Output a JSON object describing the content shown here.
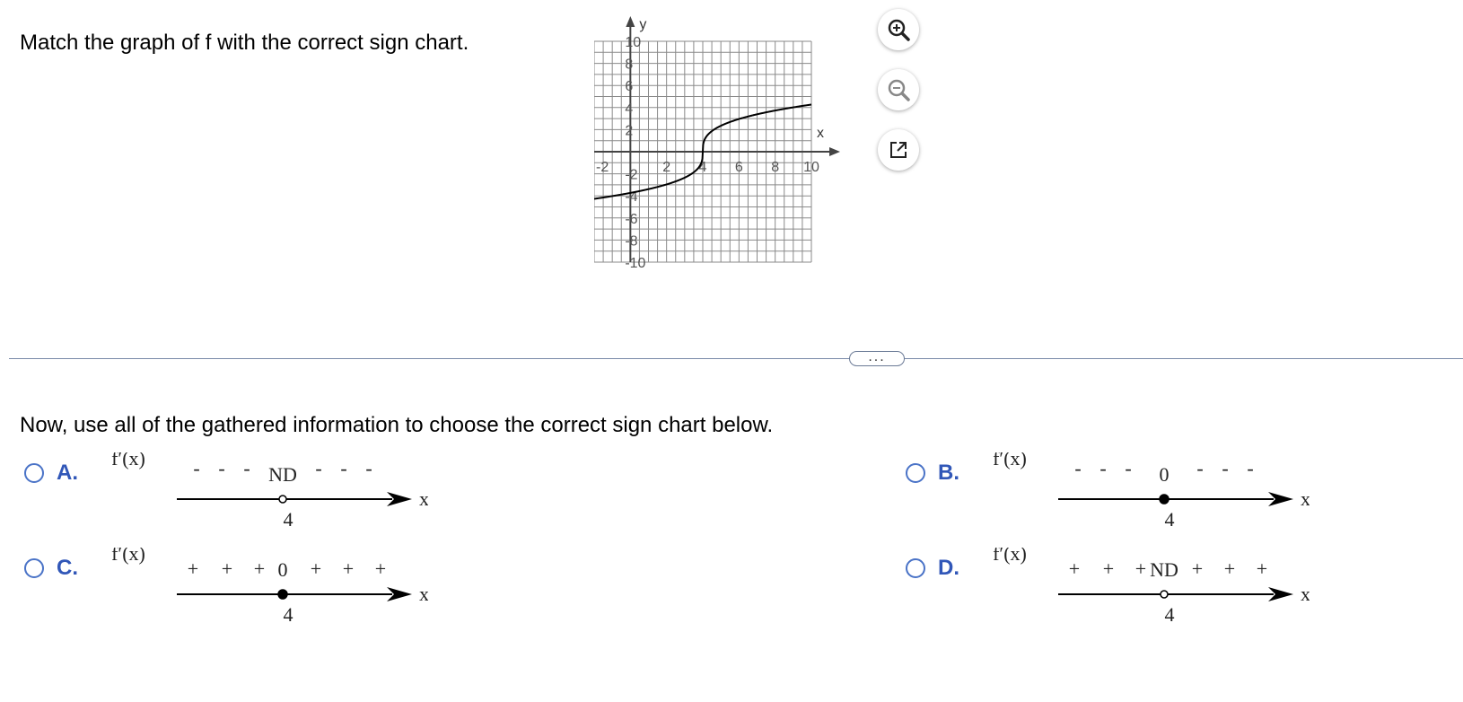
{
  "question": "Match the graph of f with the correct sign chart.",
  "graph": {
    "x_axis_label": "x",
    "y_axis_label": "y",
    "x_ticks": [
      "-2",
      "2",
      "4",
      "6",
      "8",
      "10"
    ],
    "y_ticks": [
      "10",
      "8",
      "6",
      "4",
      "2",
      "-2",
      "-4",
      "-6",
      "-8",
      "-10"
    ],
    "x_range": [
      -2,
      10
    ],
    "y_range": [
      -10,
      10
    ],
    "curve": "cube-root-like curve through (4, 0), vertical tangent at x = 4"
  },
  "tools": {
    "zoom_in_icon": "zoom-in-icon",
    "zoom_out_icon": "zoom-out-icon",
    "popout_icon": "popout-icon"
  },
  "divider_handle": "...",
  "instruction": "Now, use all of the gathered information to choose the correct sign chart below.",
  "options": [
    {
      "letter": "A.",
      "func": "f′(x)",
      "left_signs": [
        "-",
        "-",
        "-"
      ],
      "mid": "ND",
      "right_signs": [
        "-",
        "-",
        "-"
      ],
      "point": "4",
      "point_style": "open",
      "axis": "x"
    },
    {
      "letter": "B.",
      "func": "f′(x)",
      "left_signs": [
        "-",
        "-",
        "-"
      ],
      "mid": "0",
      "right_signs": [
        "-",
        "-",
        "-"
      ],
      "point": "4",
      "point_style": "closed",
      "axis": "x"
    },
    {
      "letter": "C.",
      "func": "f′(x)",
      "left_signs": [
        "+",
        "+",
        "+"
      ],
      "mid": "0",
      "right_signs": [
        "+",
        "+",
        "+"
      ],
      "point": "4",
      "point_style": "closed",
      "axis": "x"
    },
    {
      "letter": "D.",
      "func": "f′(x)",
      "left_signs": [
        "+",
        "+",
        "+"
      ],
      "mid": "ND",
      "right_signs": [
        "+",
        "+",
        "+"
      ],
      "point": "4",
      "point_style": "open",
      "axis": "x"
    }
  ],
  "colors": {
    "accent": "#3157b8",
    "radio_border": "#4a73c7",
    "divider": "#7a8aa8",
    "grid": "#8a8a8a"
  }
}
